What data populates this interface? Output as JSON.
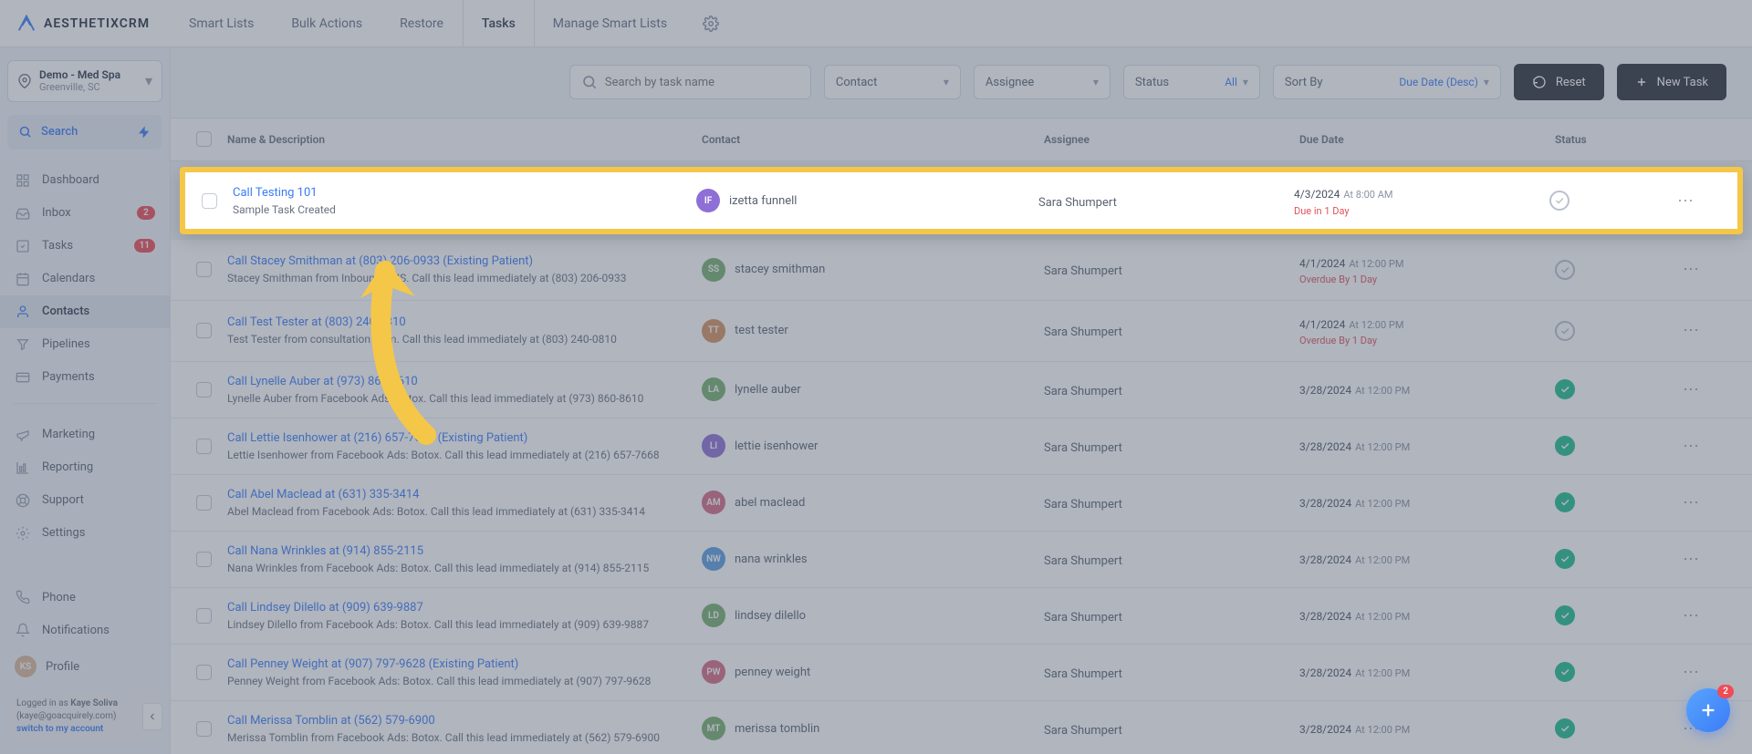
{
  "brand": {
    "name": "AESTHETIXCRM"
  },
  "topnav": {
    "tabs": [
      {
        "label": "Smart Lists"
      },
      {
        "label": "Bulk Actions"
      },
      {
        "label": "Restore"
      },
      {
        "label": "Tasks",
        "active": true
      },
      {
        "label": "Manage Smart Lists"
      }
    ]
  },
  "location": {
    "title": "Demo - Med Spa",
    "sub": "Greenville, SC"
  },
  "sidebar": {
    "search_label": "Search",
    "items": [
      {
        "label": "Dashboard",
        "icon": "grid"
      },
      {
        "label": "Inbox",
        "icon": "inbox",
        "badge": "2"
      },
      {
        "label": "Tasks",
        "icon": "check-square",
        "badge": "11"
      },
      {
        "label": "Calendars",
        "icon": "calendar"
      },
      {
        "label": "Contacts",
        "icon": "user",
        "active": true
      },
      {
        "label": "Pipelines",
        "icon": "filter"
      },
      {
        "label": "Payments",
        "icon": "card"
      }
    ],
    "items2": [
      {
        "label": "Marketing",
        "icon": "megaphone"
      },
      {
        "label": "Reporting",
        "icon": "bar"
      },
      {
        "label": "Support",
        "icon": "life"
      },
      {
        "label": "Settings",
        "icon": "gear"
      }
    ],
    "bottom": [
      {
        "label": "Phone",
        "icon": "phone"
      },
      {
        "label": "Notifications",
        "icon": "bell"
      },
      {
        "label": "Profile",
        "icon": "avatar"
      }
    ],
    "login": {
      "prefix": "Logged in as ",
      "name": "Kaye Soliva",
      "email": "(kaye@goacquirely.com)",
      "switch": "switch to my account"
    }
  },
  "toolbar": {
    "search_placeholder": "Search by task name",
    "contact": "Contact",
    "assignee": "Assignee",
    "status": "Status",
    "status_all": "All",
    "sort": "Sort By",
    "sort_val": "Due Date (Desc)",
    "reset": "Reset",
    "new": "New Task"
  },
  "columns": {
    "name": "Name & Description",
    "contact": "Contact",
    "assignee": "Assignee",
    "due": "Due Date",
    "status": "Status"
  },
  "tasks": [
    {
      "title": "Call Testing 101",
      "desc": "Sample Task Created",
      "contact": "izetta funnell",
      "initials": "IF",
      "avc": "#8e6fd6",
      "assignee": "Sara Shumpert",
      "date": "4/3/2024",
      "time": "At 8:00 AM",
      "warn": "Due in 1 Day",
      "done": false,
      "highlight": true
    },
    {
      "title": "Call Stacey Smithman at (803) 206-0933 (Existing Patient)",
      "desc": "Stacey Smithman from Inbound SMS. Call this lead immediately at (803) 206-0933",
      "contact": "stacey smithman",
      "initials": "SS",
      "avc": "#77b06d",
      "assignee": "Sara Shumpert",
      "date": "4/1/2024",
      "time": "At 12:00 PM",
      "warn": "Overdue By 1 Day",
      "done": false
    },
    {
      "title": "Call Test Tester at (803) 240-0810",
      "desc": "Test Tester from consultation form. Call this lead immediately at (803) 240-0810",
      "contact": "test tester",
      "initials": "TT",
      "avc": "#d6915f",
      "assignee": "Sara Shumpert",
      "date": "4/1/2024",
      "time": "At 12:00 PM",
      "warn": "Overdue By 1 Day",
      "done": false
    },
    {
      "title": "Call Lynelle Auber at (973) 860-8610",
      "desc": "Lynelle Auber from Facebook Ads: Botox. Call this lead immediately at (973) 860-8610",
      "contact": "lynelle auber",
      "initials": "LA",
      "avc": "#77b06d",
      "assignee": "Sara Shumpert",
      "date": "3/28/2024",
      "time": "At 12:00 PM",
      "done": true
    },
    {
      "title": "Call Lettie Isenhower at (216) 657-7668 (Existing Patient)",
      "desc": "Lettie Isenhower from Facebook Ads: Botox. Call this lead immediately at (216) 657-7668",
      "contact": "lettie isenhower",
      "initials": "LI",
      "avc": "#8e6fd6",
      "assignee": "Sara Shumpert",
      "date": "3/28/2024",
      "time": "At 12:00 PM",
      "done": true
    },
    {
      "title": "Call Abel Maclead at (631) 335-3414",
      "desc": "Abel Maclead from Facebook Ads: Botox. Call this lead immediately at (631) 335-3414",
      "contact": "abel maclead",
      "initials": "AM",
      "avc": "#d66a81",
      "assignee": "Sara Shumpert",
      "date": "3/28/2024",
      "time": "At 12:00 PM",
      "done": true
    },
    {
      "title": "Call Nana Wrinkles at (914) 855-2115",
      "desc": "Nana Wrinkles from Facebook Ads: Botox. Call this lead immediately at (914) 855-2115",
      "contact": "nana wrinkles",
      "initials": "NW",
      "avc": "#5a9de0",
      "assignee": "Sara Shumpert",
      "date": "3/28/2024",
      "time": "At 12:00 PM",
      "done": true
    },
    {
      "title": "Call Lindsey Dilello at (909) 639-9887",
      "desc": "Lindsey Dilello from Facebook Ads: Botox. Call this lead immediately at (909) 639-9887",
      "contact": "lindsey dilello",
      "initials": "LD",
      "avc": "#77b06d",
      "assignee": "Sara Shumpert",
      "date": "3/28/2024",
      "time": "At 12:00 PM",
      "done": true
    },
    {
      "title": "Call Penney Weight at (907) 797-9628 (Existing Patient)",
      "desc": "Penney Weight from Facebook Ads: Botox. Call this lead immediately at (907) 797-9628",
      "contact": "penney weight",
      "initials": "PW",
      "avc": "#d66a81",
      "assignee": "Sara Shumpert",
      "date": "3/28/2024",
      "time": "At 12:00 PM",
      "done": true
    },
    {
      "title": "Call Merissa Tomblin at (562) 579-6900",
      "desc": "Merissa Tomblin from Facebook Ads: Botox. Call this lead immediately at (562) 579-6900",
      "contact": "merissa tomblin",
      "initials": "MT",
      "avc": "#77b06d",
      "assignee": "Sara Shumpert",
      "date": "3/28/2024",
      "time": "At 12:00 PM",
      "done": true
    }
  ],
  "fab": {
    "badge": "2"
  },
  "avatar": {
    "ks": "KS"
  }
}
